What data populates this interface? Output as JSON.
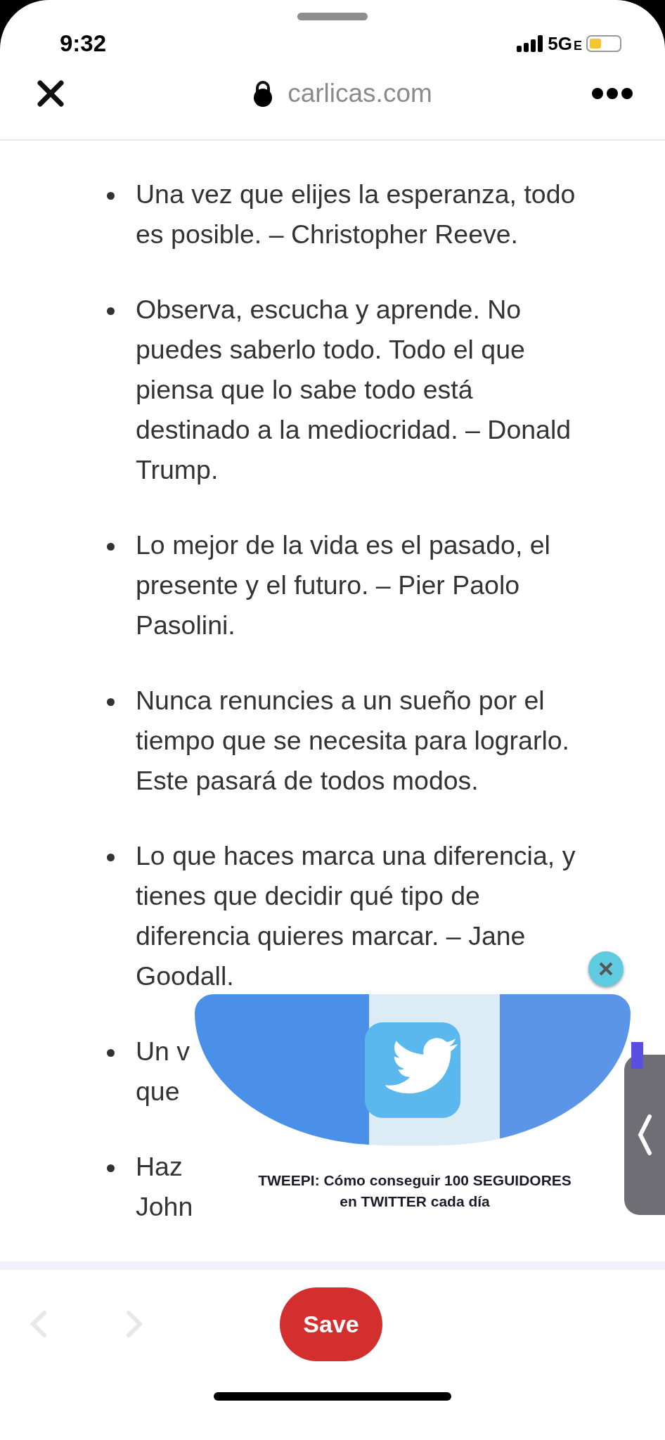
{
  "status_bar": {
    "time": "9:32",
    "network": "5G",
    "network_suffix": "E"
  },
  "browser_bar": {
    "url": "carlicas.com",
    "secure": true
  },
  "quotes": [
    {
      "lines": [
        "Una vez que elijes la esperanza, todo",
        "es posible. – Christopher Reeve."
      ]
    },
    {
      "lines": [
        "Observa, escucha y aprende. No",
        "puedes saberlo todo. Todo el que",
        "piensa que lo sabe todo está",
        "destinado a la mediocridad. – Donald",
        "Trump."
      ]
    },
    {
      "lines": [
        "Lo mejor de la vida es el pasado, el",
        "presente y el futuro. – Pier Paolo",
        "Pasolini."
      ]
    },
    {
      "lines": [
        "Nunca renuncies a un sueño por el",
        "tiempo que se necesita para lograrlo.",
        "Este pasará de todos modos."
      ]
    },
    {
      "lines": [
        "Lo que haces marca una diferencia, y",
        "tienes que decidir qué tipo de",
        "diferencia quieres marcar. – Jane",
        "Goodall."
      ]
    },
    {
      "lines": [
        "Un v",
        "que"
      ]
    },
    {
      "lines": [
        "Haz",
        "John"
      ]
    }
  ],
  "video_ad": {
    "caption_lines": [
      "TWEEPI: Cómo conseguir 100 SEGUIDORES",
      "en TWITTER cada día"
    ]
  },
  "bottom_toolbar": {
    "back_disabled": true,
    "forward_disabled": true,
    "save_label": "Save"
  }
}
